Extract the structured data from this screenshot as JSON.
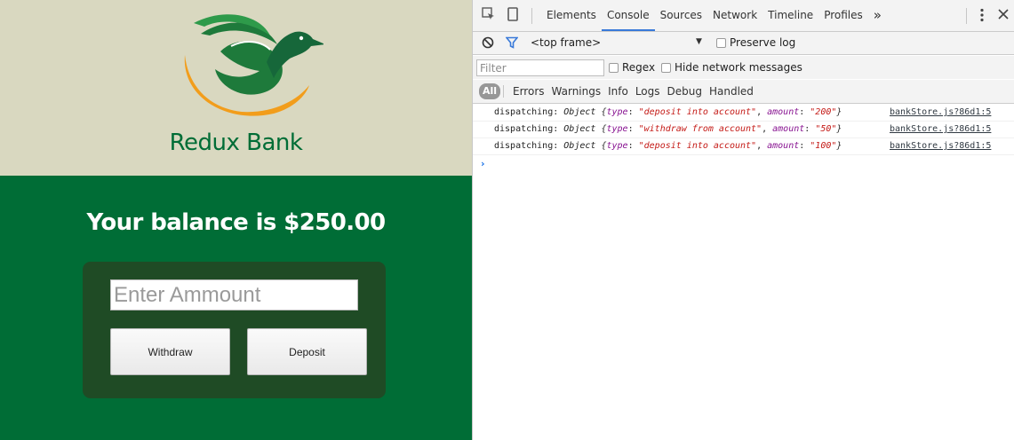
{
  "app": {
    "bank_name": "Redux Bank",
    "balance_text": "Your balance is $250.00",
    "amount_placeholder": "Enter Ammount",
    "withdraw_label": "Withdraw",
    "deposit_label": "Deposit",
    "colors": {
      "header_bg": "#d9d8c0",
      "main_bg": "#006d36",
      "panel_bg": "#1f4b25",
      "logo_orange": "#f29d1b",
      "logo_green": "#1e7a3b"
    },
    "logo_icon": "duck-logo-icon"
  },
  "devtools": {
    "tabs": [
      {
        "label": "Elements"
      },
      {
        "label": "Console",
        "active": true
      },
      {
        "label": "Sources"
      },
      {
        "label": "Network"
      },
      {
        "label": "Timeline"
      },
      {
        "label": "Profiles"
      }
    ],
    "more_tabs_glyph": "»",
    "toolbar": {
      "frame": "<top frame>",
      "preserve_log_label": "Preserve log"
    },
    "filter": {
      "placeholder": "Filter",
      "regex_label": "Regex",
      "hide_network_label": "Hide network messages"
    },
    "levels": {
      "all_label": "All",
      "items": [
        "Errors",
        "Warnings",
        "Info",
        "Logs",
        "Debug",
        "Handled"
      ]
    },
    "logs": [
      {
        "prefix": "dispatching:",
        "obj": "Object",
        "type": "\"deposit into account\"",
        "amount": "\"200\"",
        "source": "bankStore.js?86d1:5"
      },
      {
        "prefix": "dispatching:",
        "obj": "Object",
        "type": "\"withdraw from account\"",
        "amount": "\"50\"",
        "source": "bankStore.js?86d1:5"
      },
      {
        "prefix": "dispatching:",
        "obj": "Object",
        "type": "\"deposit into account\"",
        "amount": "\"100\"",
        "source": "bankStore.js?86d1:5"
      }
    ],
    "icons": {
      "inspect": "inspect-element-icon",
      "device": "device-mode-icon",
      "clear": "clear-console-icon",
      "filter": "filter-icon",
      "menu": "kebab-menu-icon",
      "close": "close-icon"
    }
  }
}
